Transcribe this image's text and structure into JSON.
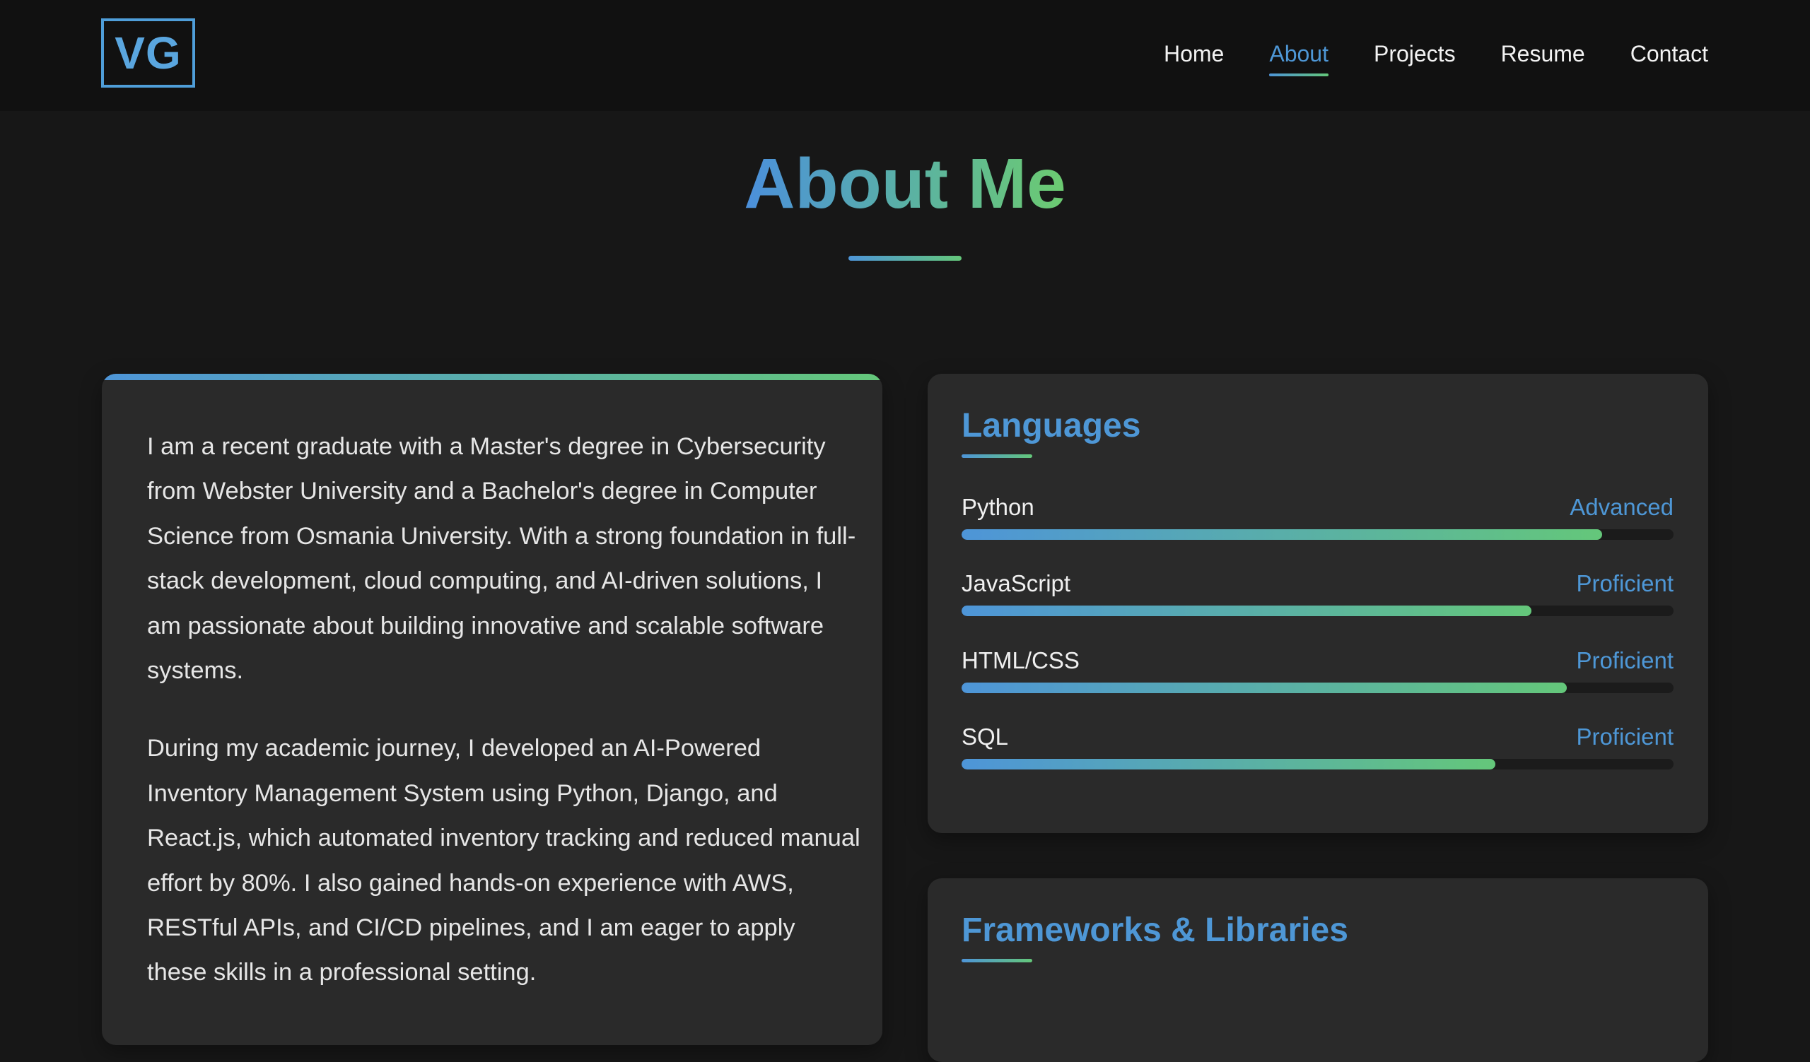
{
  "header": {
    "logo": "VG",
    "nav": [
      {
        "label": "Home",
        "active": false
      },
      {
        "label": "About",
        "active": true
      },
      {
        "label": "Projects",
        "active": false
      },
      {
        "label": "Resume",
        "active": false
      },
      {
        "label": "Contact",
        "active": false
      }
    ]
  },
  "page": {
    "title": "About Me"
  },
  "bio": {
    "paragraphs": [
      "I am a recent graduate with a Master's degree in Cybersecurity from Webster University and a Bachelor's degree in Computer Science from Osmania University. With a strong foundation in full-stack development, cloud computing, and AI-driven solutions, I am passionate about building innovative and scalable software systems.",
      "During my academic journey, I developed an AI-Powered Inventory Management System using Python, Django, and React.js, which automated inventory tracking and reduced manual effort by 80%. I also gained hands-on experience with AWS, RESTful APIs, and CI/CD pipelines, and I am eager to apply these skills in a professional setting."
    ]
  },
  "languages": {
    "heading": "Languages",
    "skills": [
      {
        "name": "Python",
        "level": "Advanced",
        "progress": 0.9
      },
      {
        "name": "JavaScript",
        "level": "Proficient",
        "progress": 0.8
      },
      {
        "name": "HTML/CSS",
        "level": "Proficient",
        "progress": 0.85
      },
      {
        "name": "SQL",
        "level": "Proficient",
        "progress": 0.75
      }
    ]
  },
  "frameworks": {
    "heading": "Frameworks & Libraries"
  },
  "colors": {
    "background": "#171717",
    "header": "#111111",
    "card": "#2a2a2a",
    "accent_blue": "#4e97d6",
    "accent_green": "#64c77a"
  }
}
